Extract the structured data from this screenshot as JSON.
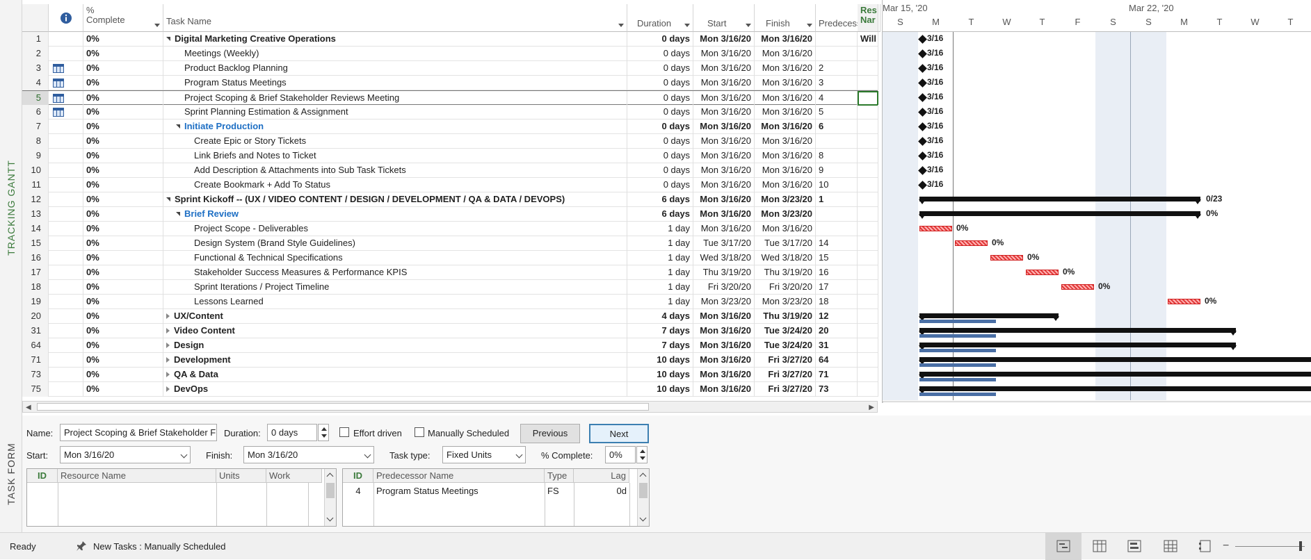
{
  "side_labels": {
    "gantt": "TRACKING GANTT",
    "form": "TASK FORM"
  },
  "columns": {
    "pct_line1": "%",
    "pct_line2": "Complete",
    "task_name": "Task Name",
    "duration": "Duration",
    "start": "Start",
    "finish": "Finish",
    "predecessors": "Predecesso",
    "resource_line1": "Res",
    "resource_line2": "Nar"
  },
  "rows": [
    {
      "id": "1",
      "pct": "0%",
      "name": "Digital Marketing Creative Operations",
      "duration": "0 days",
      "start": "Mon 3/16/20",
      "finish": "Mon 3/16/20",
      "pred": "",
      "res": "Will",
      "level": 0,
      "summary": "open",
      "bold": true,
      "icon": false
    },
    {
      "id": "2",
      "pct": "0%",
      "name": "Meetings (Weekly)",
      "duration": "0 days",
      "start": "Mon 3/16/20",
      "finish": "Mon 3/16/20",
      "pred": "",
      "res": "",
      "level": 1,
      "summary": "",
      "bold": false,
      "icon": false
    },
    {
      "id": "3",
      "pct": "0%",
      "name": "Product Backlog Planning",
      "duration": "0 days",
      "start": "Mon 3/16/20",
      "finish": "Mon 3/16/20",
      "pred": "2",
      "res": "",
      "level": 1,
      "summary": "",
      "bold": false,
      "icon": true
    },
    {
      "id": "4",
      "pct": "0%",
      "name": "Program Status Meetings",
      "duration": "0 days",
      "start": "Mon 3/16/20",
      "finish": "Mon 3/16/20",
      "pred": "3",
      "res": "",
      "level": 1,
      "summary": "",
      "bold": false,
      "icon": true
    },
    {
      "id": "5",
      "pct": "0%",
      "name": "Project Scoping & Brief Stakeholder Reviews Meeting",
      "duration": "0 days",
      "start": "Mon 3/16/20",
      "finish": "Mon 3/16/20",
      "pred": "4",
      "res": "",
      "level": 1,
      "summary": "",
      "bold": false,
      "icon": true
    },
    {
      "id": "6",
      "pct": "0%",
      "name": "Sprint Planning Estimation & Assignment",
      "duration": "0 days",
      "start": "Mon 3/16/20",
      "finish": "Mon 3/16/20",
      "pred": "5",
      "res": "",
      "level": 1,
      "summary": "",
      "bold": false,
      "icon": true
    },
    {
      "id": "7",
      "pct": "0%",
      "name": "Initiate Production",
      "duration": "0 days",
      "start": "Mon 3/16/20",
      "finish": "Mon 3/16/20",
      "pred": "6",
      "res": "",
      "level": 1,
      "summary": "open",
      "bold": true,
      "blue": true,
      "icon": false
    },
    {
      "id": "8",
      "pct": "0%",
      "name": "Create Epic or Story Tickets",
      "duration": "0 days",
      "start": "Mon 3/16/20",
      "finish": "Mon 3/16/20",
      "pred": "",
      "res": "",
      "level": 2,
      "summary": "",
      "bold": false,
      "icon": false
    },
    {
      "id": "9",
      "pct": "0%",
      "name": "Link Briefs and Notes to Ticket",
      "duration": "0 days",
      "start": "Mon 3/16/20",
      "finish": "Mon 3/16/20",
      "pred": "8",
      "res": "",
      "level": 2,
      "summary": "",
      "bold": false,
      "icon": false
    },
    {
      "id": "10",
      "pct": "0%",
      "name": "Add Description & Attachments into Sub Task Tickets",
      "duration": "0 days",
      "start": "Mon 3/16/20",
      "finish": "Mon 3/16/20",
      "pred": "9",
      "res": "",
      "level": 2,
      "summary": "",
      "bold": false,
      "icon": false
    },
    {
      "id": "11",
      "pct": "0%",
      "name": "Create Bookmark + Add To Status",
      "duration": "0 days",
      "start": "Mon 3/16/20",
      "finish": "Mon 3/16/20",
      "pred": "10",
      "res": "",
      "level": 2,
      "summary": "",
      "bold": false,
      "icon": false
    },
    {
      "id": "12",
      "pct": "0%",
      "name": "Sprint Kickoff -- (UX / VIDEO CONTENT / DESIGN / DEVELOPMENT / QA & DATA / DEVOPS)",
      "duration": "6 days",
      "start": "Mon 3/16/20",
      "finish": "Mon 3/23/20",
      "pred": "1",
      "res": "",
      "level": 0,
      "summary": "open",
      "bold": true,
      "icon": false
    },
    {
      "id": "13",
      "pct": "0%",
      "name": "Brief Review",
      "duration": "6 days",
      "start": "Mon 3/16/20",
      "finish": "Mon 3/23/20",
      "pred": "",
      "res": "",
      "level": 1,
      "summary": "open",
      "bold": true,
      "blue": true,
      "icon": false
    },
    {
      "id": "14",
      "pct": "0%",
      "name": "Project Scope - Deliverables",
      "duration": "1 day",
      "start": "Mon 3/16/20",
      "finish": "Mon 3/16/20",
      "pred": "",
      "res": "",
      "level": 2,
      "summary": "",
      "bold": false,
      "icon": false
    },
    {
      "id": "15",
      "pct": "0%",
      "name": "Design System (Brand Style Guidelines)",
      "duration": "1 day",
      "start": "Tue 3/17/20",
      "finish": "Tue 3/17/20",
      "pred": "14",
      "res": "",
      "level": 2,
      "summary": "",
      "bold": false,
      "icon": false
    },
    {
      "id": "16",
      "pct": "0%",
      "name": "Functional & Technical Specifications",
      "duration": "1 day",
      "start": "Wed 3/18/20",
      "finish": "Wed 3/18/20",
      "pred": "15",
      "res": "",
      "level": 2,
      "summary": "",
      "bold": false,
      "icon": false
    },
    {
      "id": "17",
      "pct": "0%",
      "name": "Stakeholder Success Measures & Performance KPIS",
      "duration": "1 day",
      "start": "Thu 3/19/20",
      "finish": "Thu 3/19/20",
      "pred": "16",
      "res": "",
      "level": 2,
      "summary": "",
      "bold": false,
      "icon": false
    },
    {
      "id": "18",
      "pct": "0%",
      "name": "Sprint Iterations / Project Timeline",
      "duration": "1 day",
      "start": "Fri 3/20/20",
      "finish": "Fri 3/20/20",
      "pred": "17",
      "res": "",
      "level": 2,
      "summary": "",
      "bold": false,
      "icon": false
    },
    {
      "id": "19",
      "pct": "0%",
      "name": "Lessons Learned",
      "duration": "1 day",
      "start": "Mon 3/23/20",
      "finish": "Mon 3/23/20",
      "pred": "18",
      "res": "",
      "level": 2,
      "summary": "",
      "bold": false,
      "icon": false
    },
    {
      "id": "20",
      "pct": "0%",
      "name": "UX/Content",
      "duration": "4 days",
      "start": "Mon 3/16/20",
      "finish": "Thu 3/19/20",
      "pred": "12",
      "res": "",
      "level": 0,
      "summary": "closed",
      "bold": true,
      "icon": false
    },
    {
      "id": "31",
      "pct": "0%",
      "name": "Video Content",
      "duration": "7 days",
      "start": "Mon 3/16/20",
      "finish": "Tue 3/24/20",
      "pred": "20",
      "res": "",
      "level": 0,
      "summary": "closed",
      "bold": true,
      "icon": false
    },
    {
      "id": "64",
      "pct": "0%",
      "name": "Design",
      "duration": "7 days",
      "start": "Mon 3/16/20",
      "finish": "Tue 3/24/20",
      "pred": "31",
      "res": "",
      "level": 0,
      "summary": "closed",
      "bold": true,
      "icon": false
    },
    {
      "id": "71",
      "pct": "0%",
      "name": "Development",
      "duration": "10 days",
      "start": "Mon 3/16/20",
      "finish": "Fri 3/27/20",
      "pred": "64",
      "res": "",
      "level": 0,
      "summary": "closed",
      "bold": true,
      "icon": false
    },
    {
      "id": "73",
      "pct": "0%",
      "name": "QA & Data",
      "duration": "10 days",
      "start": "Mon 3/16/20",
      "finish": "Fri 3/27/20",
      "pred": "71",
      "res": "",
      "level": 0,
      "summary": "closed",
      "bold": true,
      "icon": false
    },
    {
      "id": "75",
      "pct": "0%",
      "name": "DevOps",
      "duration": "10 days",
      "start": "Mon 3/16/20",
      "finish": "Fri 3/27/20",
      "pred": "73",
      "res": "",
      "level": 0,
      "summary": "closed",
      "bold": true,
      "icon": false
    }
  ],
  "selected_row": "5",
  "timescale": {
    "weeks": [
      "Mar 15, '20",
      "Mar 22, '20"
    ],
    "days": [
      "S",
      "M",
      "T",
      "W",
      "T",
      "F",
      "S",
      "S",
      "M",
      "T",
      "W",
      "T"
    ]
  },
  "gantt_labels": {
    "milestone_date": "3/16",
    "sprint_end": "0/23",
    "pct": "0%"
  },
  "task_form": {
    "name_label": "Name:",
    "name_value": "Project Scoping & Brief Stakeholder F",
    "duration_label": "Duration:",
    "duration_value": "0 days",
    "effort_driven": "Effort driven",
    "manually_scheduled": "Manually Scheduled",
    "previous": "Previous",
    "next": "Next",
    "start_label": "Start:",
    "start_value": "Mon 3/16/20",
    "finish_label": "Finish:",
    "finish_value": "Mon 3/16/20",
    "task_type_label": "Task type:",
    "task_type_value": "Fixed Units",
    "pct_label": "% Complete:",
    "pct_value": "0%",
    "res_cols": [
      "ID",
      "Resource Name",
      "Units",
      "Work"
    ],
    "pred_cols": [
      "ID",
      "Predecessor Name",
      "Type",
      "Lag"
    ],
    "pred_row": {
      "id": "4",
      "name": "Program Status Meetings",
      "type": "FS",
      "lag": "0d"
    }
  },
  "status": {
    "ready": "Ready",
    "new_tasks": "New Tasks : Manually Scheduled"
  }
}
